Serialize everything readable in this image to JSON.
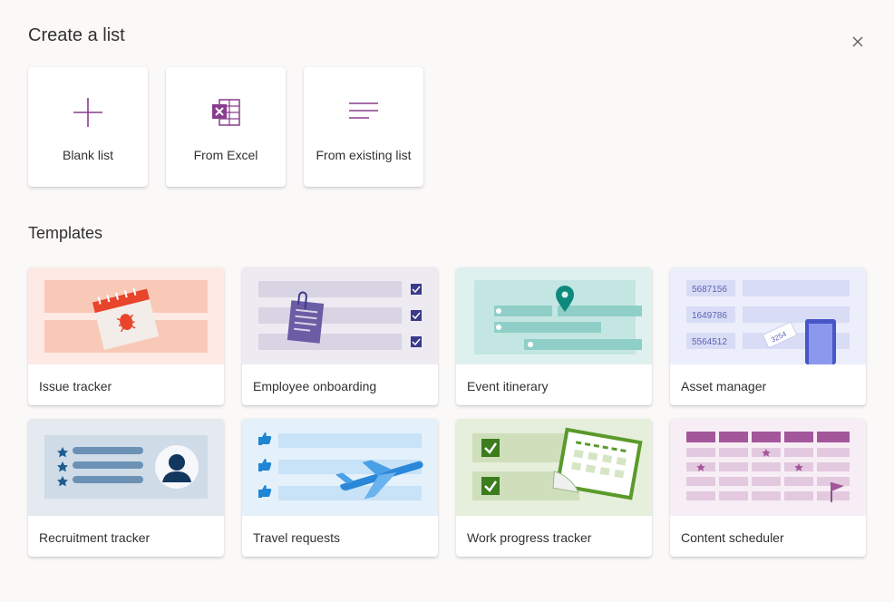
{
  "dialog": {
    "title": "Create a list",
    "close_icon": "close-icon"
  },
  "quick_actions": [
    {
      "label": "Blank list",
      "icon": "plus-icon"
    },
    {
      "label": "From Excel",
      "icon": "excel-icon"
    },
    {
      "label": "From existing list",
      "icon": "list-lines-icon"
    }
  ],
  "templates_heading": "Templates",
  "templates": [
    {
      "name": "Issue tracker"
    },
    {
      "name": "Employee onboarding"
    },
    {
      "name": "Event itinerary"
    },
    {
      "name": "Asset manager",
      "art_numbers": [
        "5687156",
        "1649786",
        "5564512"
      ],
      "tag_number": "3254"
    },
    {
      "name": "Recruitment tracker"
    },
    {
      "name": "Travel requests"
    },
    {
      "name": "Work progress tracker"
    },
    {
      "name": "Content scheduler"
    }
  ],
  "colors": {
    "accent_purple": "#8a3c8f",
    "background": "#faf9f8",
    "card": "#ffffff"
  }
}
